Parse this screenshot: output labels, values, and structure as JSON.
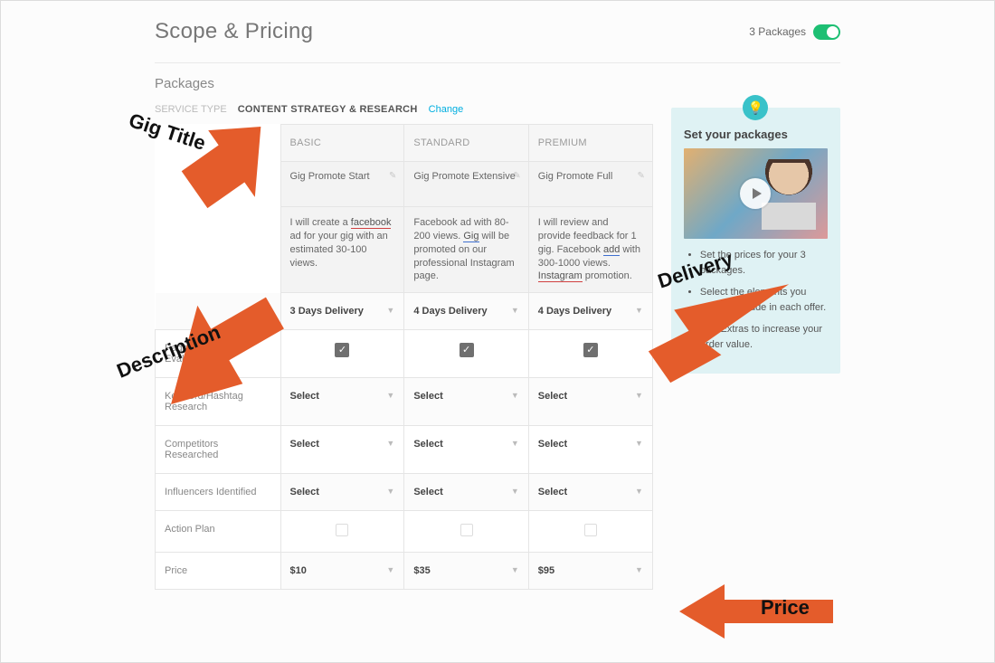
{
  "header": {
    "title": "Scope & Pricing",
    "packages_toggle_label": "3 Packages"
  },
  "sections": {
    "packages_label": "Packages"
  },
  "service": {
    "type_label": "SERVICE TYPE",
    "value": "CONTENT STRATEGY & RESEARCH",
    "change_label": "Change"
  },
  "packages": {
    "columns": [
      {
        "key": "basic",
        "header": "BASIC",
        "title": "Gig Promote Start",
        "desc_parts": [
          "I will create a ",
          "facebook",
          " ad for your gig with an estimated 30-100 views."
        ],
        "delivery": "3 Days Delivery"
      },
      {
        "key": "standard",
        "header": "STANDARD",
        "title": "Gig Promote Extensive",
        "desc_parts": [
          "Facebook ad with 80-200 views. ",
          "Gig",
          " will be promoted on our professional Instagram page."
        ],
        "delivery": "4 Days Delivery"
      },
      {
        "key": "premium",
        "header": "PREMIUM",
        "title": "Gig Promote Full",
        "desc_parts": [
          "I will review and provide feedback for 1 gig. Facebook ",
          "add",
          " with 300-1000 views. ",
          "Instagram",
          " promotion."
        ],
        "delivery": "4 Days Delivery"
      }
    ],
    "rows": [
      {
        "key": "page_channel_eval",
        "label": "Page/Channel Evaluation",
        "type": "check",
        "values": [
          true,
          true,
          true
        ]
      },
      {
        "key": "keyword_research",
        "label": "Keyword/Hashtag Research",
        "type": "select",
        "values": [
          "Select",
          "Select",
          "Select"
        ]
      },
      {
        "key": "competitors",
        "label": "Competitors Researched",
        "type": "select",
        "values": [
          "Select",
          "Select",
          "Select"
        ]
      },
      {
        "key": "influencers",
        "label": "Influencers Identified",
        "type": "select",
        "values": [
          "Select",
          "Select",
          "Select"
        ]
      },
      {
        "key": "action_plan",
        "label": "Action Plan",
        "type": "check",
        "values": [
          false,
          false,
          false
        ]
      },
      {
        "key": "price",
        "label": "Price",
        "type": "select",
        "values": [
          "$10",
          "$35",
          "$95"
        ]
      }
    ]
  },
  "tip": {
    "title": "Set your packages",
    "bullets": [
      "Set the prices for your 3 packages.",
      "Select the elements you want to include in each offer.",
      "Add Extras to increase your order value."
    ]
  },
  "annotations": {
    "gig_title": "Gig Title",
    "description": "Description",
    "delivery": "Delivery",
    "price": "Price"
  }
}
